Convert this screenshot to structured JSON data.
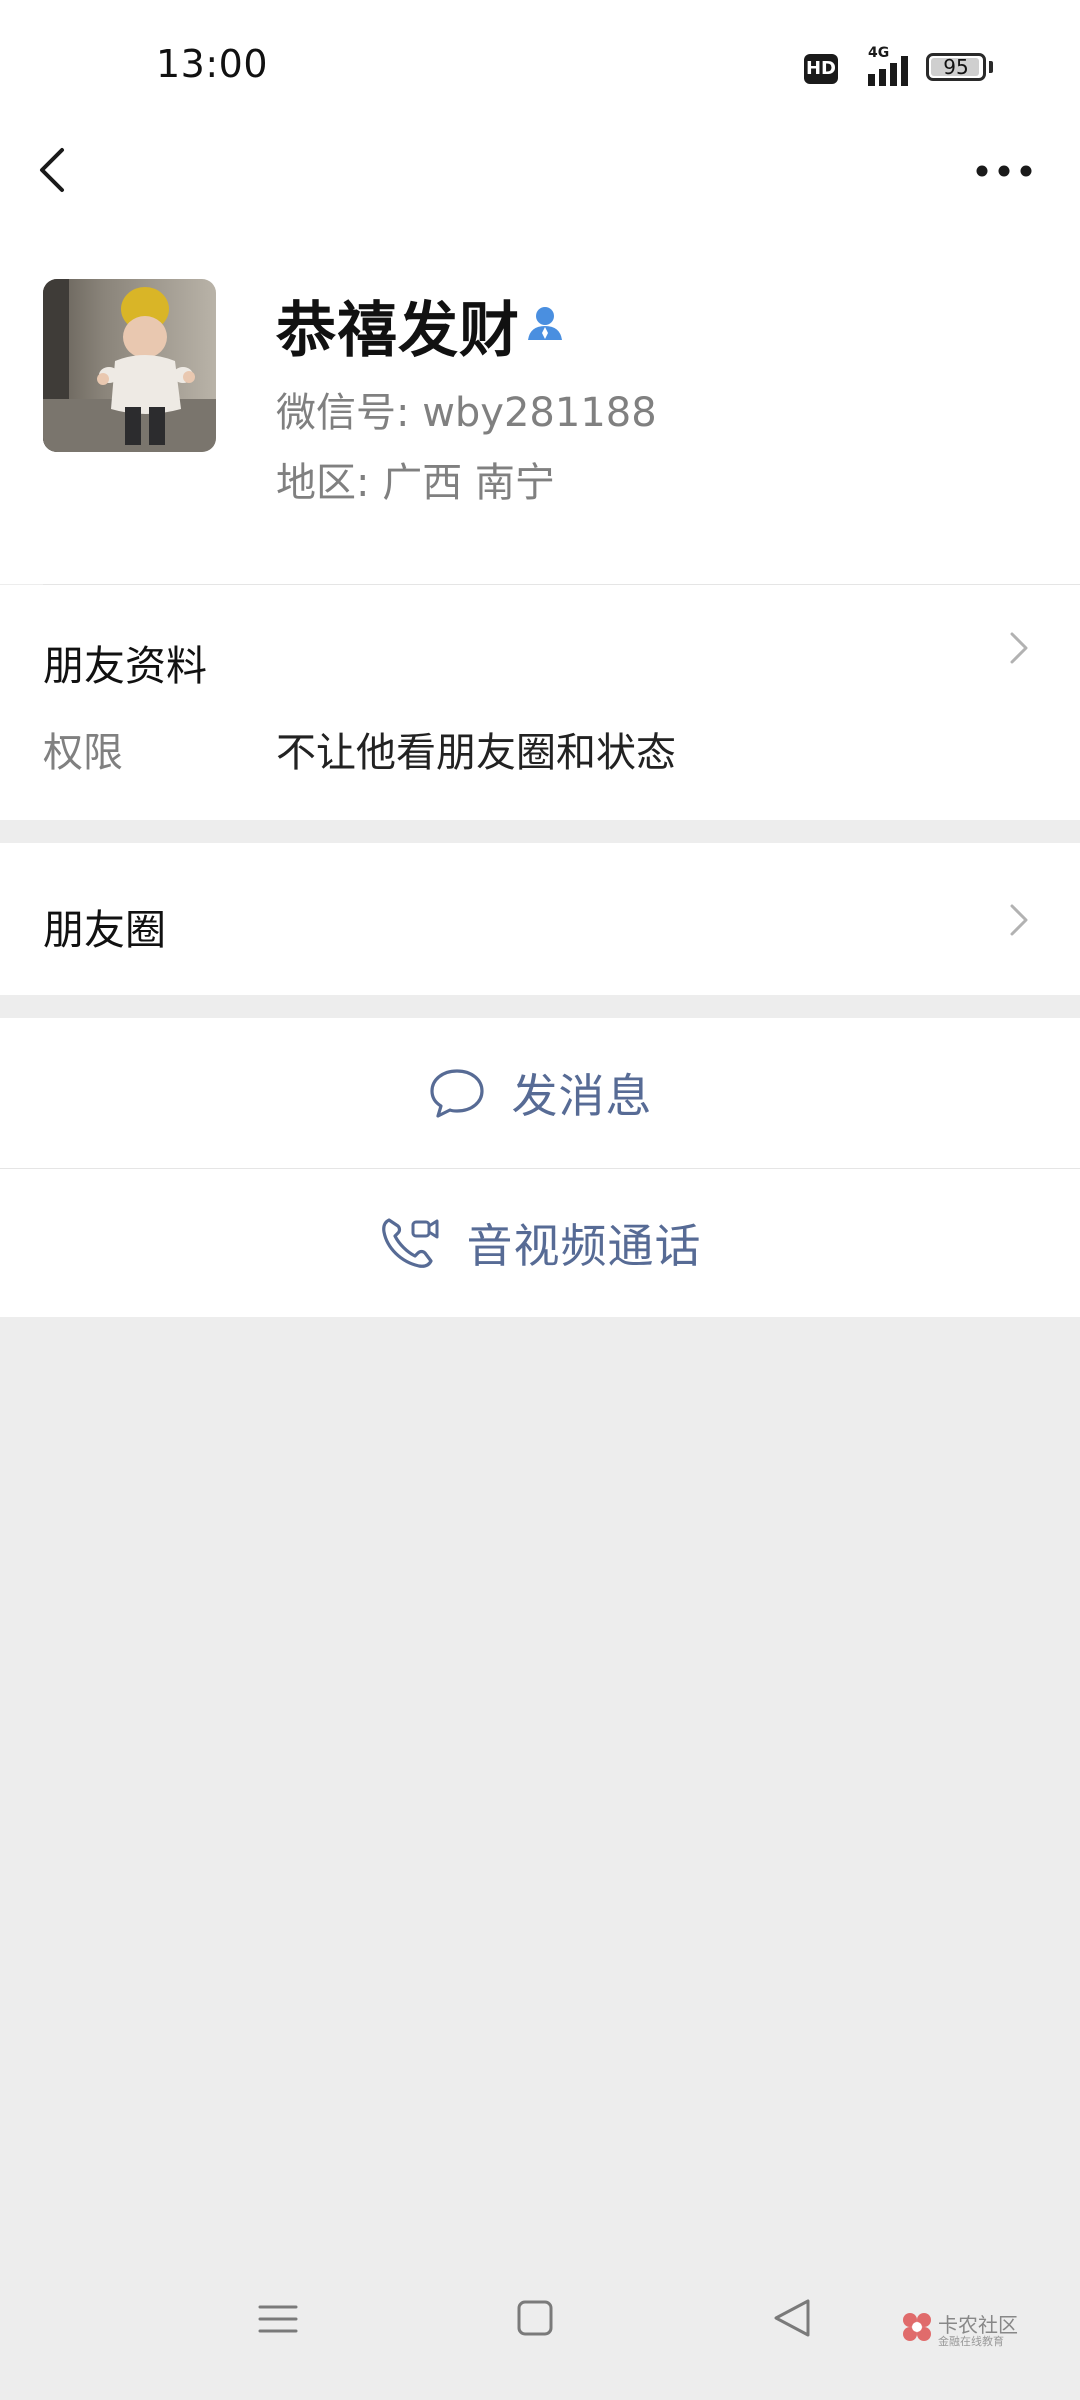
{
  "status_bar": {
    "time": "13:00",
    "hd_label": "HD",
    "network_label": "4G",
    "battery": "95",
    "battery_level": 0.95
  },
  "nav": {
    "back_icon": "chevron-left-icon",
    "more_icon": "more-dots-icon"
  },
  "profile": {
    "name": "恭禧发财",
    "wechat_id": "微信号: wby281188",
    "region": "地区: 广西  南宁",
    "verified_icon": "person-icon",
    "accent": "#4a8fe0"
  },
  "friend_info": {
    "title": "朋友资料",
    "permission_label": "权限",
    "permission_value": "不让他看朋友圈和状态"
  },
  "moments": {
    "title": "朋友圈"
  },
  "actions": {
    "message": "发消息",
    "call": "音视频通话",
    "color": "#576b95"
  },
  "system_nav": {
    "menu_icon": "menu-icon",
    "home_icon": "home-square-icon",
    "back_icon": "back-triangle-icon"
  },
  "watermark": {
    "title": "卡农社区",
    "subtitle": "金融在线教育"
  }
}
